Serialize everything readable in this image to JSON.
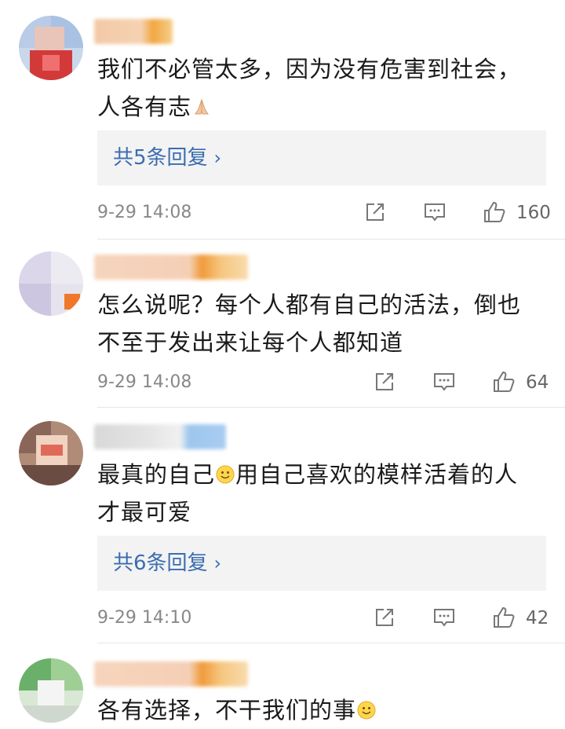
{
  "comments": [
    {
      "text": "我们不必管太多，因为没有危害到社会，人各有志",
      "emoji": "folded-hands",
      "reply_label": "共5条回复",
      "timestamp": "9-29 14:08",
      "likes": "160"
    },
    {
      "text": "怎么说呢？每个人都有自己的活法，倒也不至于发出来让每个人都知道",
      "reply_label": "",
      "timestamp": "9-29 14:08",
      "likes": "64"
    },
    {
      "text_before": "最真的自己",
      "emoji": "smile",
      "text_after": "用自己喜欢的模样活着的人才最可爱",
      "reply_label": "共6条回复",
      "timestamp": "9-29 14:10",
      "likes": "42"
    },
    {
      "text": "各有选择，不干我们的事",
      "emoji": "smile"
    }
  ],
  "icons": {
    "share": "share-icon",
    "reply": "comment-icon",
    "like": "thumbs-up-icon",
    "chevron": "chevron-right-icon"
  },
  "colors": {
    "link": "#3b6db0",
    "meta": "#888888",
    "reply_bg": "#f3f3f3"
  }
}
